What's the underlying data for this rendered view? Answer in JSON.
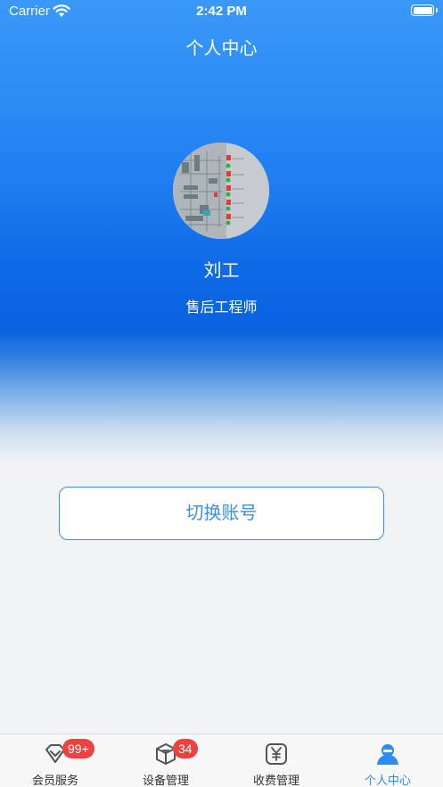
{
  "status_bar": {
    "carrier": "Carrier",
    "time": "2:42 PM"
  },
  "header": {
    "title": "个人中心"
  },
  "profile": {
    "name": "刘工",
    "role": "售后工程师"
  },
  "actions": {
    "switch_account": "切换账号"
  },
  "tab_bar": {
    "tabs": [
      {
        "label": "会员服务",
        "icon": "diamond-icon",
        "badge": "99+",
        "active": false
      },
      {
        "label": "设备管理",
        "icon": "box-icon",
        "badge": "34",
        "active": false
      },
      {
        "label": "收费管理",
        "icon": "yen-icon",
        "badge": "",
        "active": false
      },
      {
        "label": "个人中心",
        "icon": "person-icon",
        "badge": "",
        "active": true
      }
    ]
  },
  "colors": {
    "accent": "#2c8cf0",
    "badge": "#f04040",
    "header_gradient_top": "#3a98f8",
    "header_gradient_mid": "#0a62df"
  }
}
